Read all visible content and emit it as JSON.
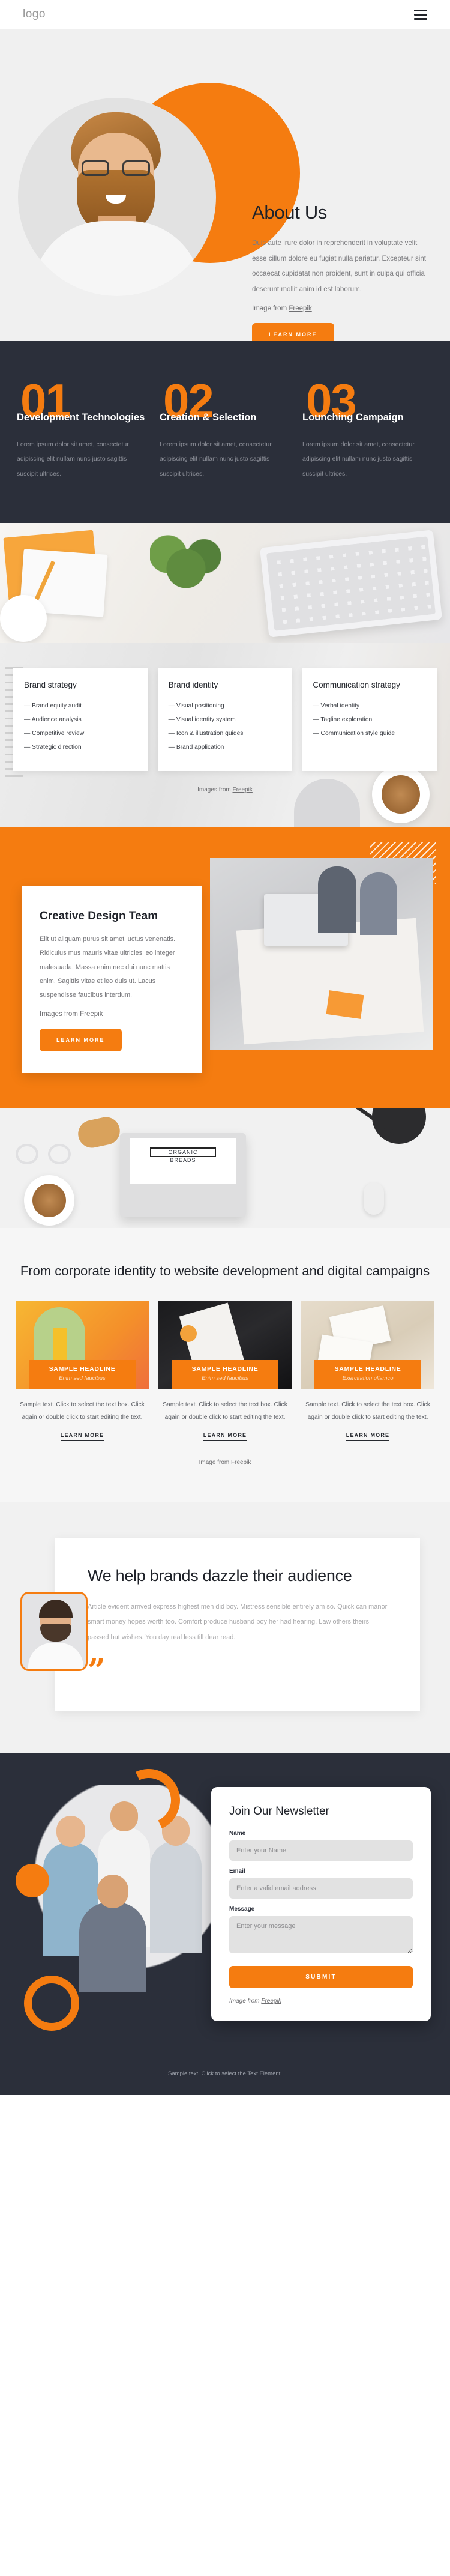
{
  "header": {
    "logo": "logo",
    "menu_icon": "hamburger-icon"
  },
  "hero": {
    "about_title": "About Us",
    "about_body": "Duis aute irure dolor in reprehenderit in voluptate velit esse cillum dolore eu fugiat nulla pariatur. Excepteur sint occaecat cupidatat non proident, sunt in culpa qui officia deserunt mollit anim id est laborum.",
    "credit_prefix": "Image from ",
    "credit_link": "Freepik",
    "cta": "LEARN MORE"
  },
  "steps": [
    {
      "num": "01",
      "title": "Development Technologies",
      "body": "Lorem ipsum dolor sit amet, consectetur adipiscing elit nullam nunc justo sagittis suscipit ultrices."
    },
    {
      "num": "02",
      "title": "Creation & Selection",
      "body": "Lorem ipsum dolor sit amet, consectetur adipiscing elit nullam nunc justo sagittis suscipit ultrices."
    },
    {
      "num": "03",
      "title": "Lounching Campaign",
      "body": "Lorem ipsum dolor sit amet, consectetur adipiscing elit nullam nunc justo sagittis suscipit ultrices."
    }
  ],
  "strategy": {
    "cards": [
      {
        "title": "Brand strategy",
        "items": [
          "— Brand equity audit",
          "— Audience analysis",
          "— Competitive review",
          "— Strategic direction"
        ]
      },
      {
        "title": "Brand identity",
        "items": [
          "— Visual positioning",
          "— Visual identity system",
          "— Icon & illustration guides",
          "— Brand application"
        ]
      },
      {
        "title": "Communication strategy",
        "items": [
          "— Verbal identity",
          "— Tagline exploration",
          "— Communication style guide"
        ]
      }
    ],
    "credit_prefix": "Images from ",
    "credit_link": "Freepik"
  },
  "team": {
    "title": "Creative Design Team",
    "body": "Elit ut aliquam purus sit amet luctus venenatis. Ridiculus mus mauris vitae ultricies leo integer malesuada. Massa enim nec dui nunc mattis enim. Sagittis vitae et leo duis ut. Lacus suspendisse faucibus interdum.",
    "credit_prefix": "Images from ",
    "credit_link": "Freepik",
    "cta": "LEARN MORE"
  },
  "portfolio": {
    "heading": "From corporate identity to website development and digital campaigns",
    "cards": [
      {
        "headline": "SAMPLE HEADLINE",
        "subhead": "Enim sed faucibus",
        "desc": "Sample text. Click to select the text box. Click again or double click to start editing the text.",
        "link": "LEARN MORE"
      },
      {
        "headline": "SAMPLE HEADLINE",
        "subhead": "Enim sed faucibus",
        "desc": "Sample text. Click to select the text box. Click again or double click to start editing the text.",
        "link": "LEARN MORE"
      },
      {
        "headline": "SAMPLE HEADLINE",
        "subhead": "Exercitation ullamco",
        "desc": "Sample text. Click to select the text box. Click again or double click to start editing the text.",
        "link": "LEARN MORE"
      }
    ],
    "credit_prefix": "Image from ",
    "credit_link": "Freepik"
  },
  "brands": {
    "title": "We help brands dazzle their audience",
    "body": "Article evident arrived express highest men did boy. Mistress sensible entirely am so. Quick can manor smart money hopes worth too. Comfort produce husband boy her had hearing. Law others theirs passed but wishes. You day real less till dear read.",
    "quote_glyph": "”"
  },
  "newsletter": {
    "title": "Join Our Newsletter",
    "name_label": "Name",
    "name_placeholder": "Enter your Name",
    "email_label": "Email",
    "email_placeholder": "Enter a valid email address",
    "message_label": "Message",
    "message_placeholder": "Enter your message",
    "submit": "SUBMIT",
    "credit_prefix": "Image from ",
    "credit_link": "Freepik"
  },
  "footer": {
    "text": "Sample text. Click to select the Text Element."
  },
  "colors": {
    "accent": "#f57c10",
    "dark": "#2b2f3a",
    "light": "#f1f1f1"
  }
}
